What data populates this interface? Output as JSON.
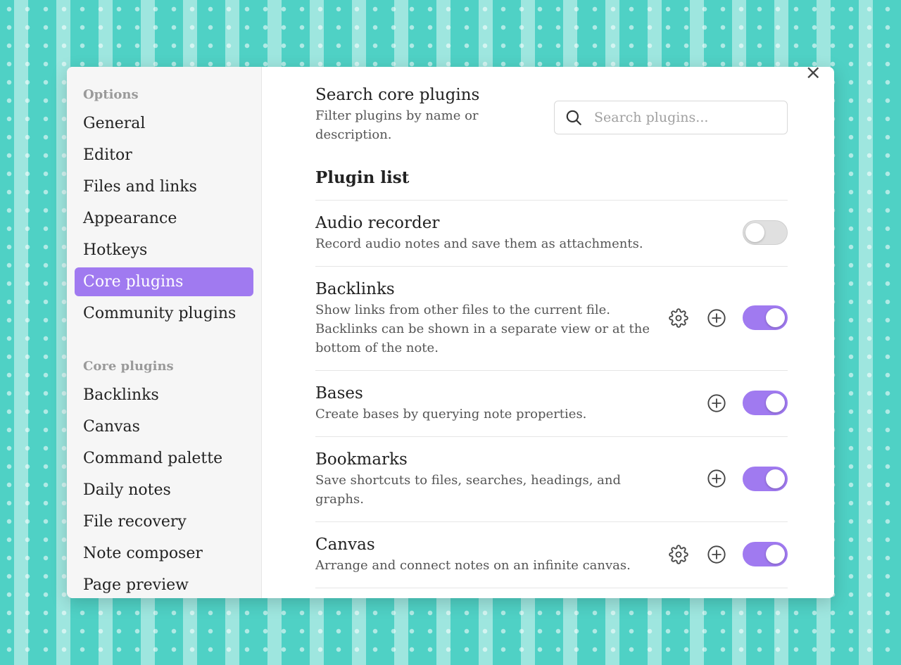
{
  "sidebar": {
    "options_heading": "Options",
    "options_items": [
      {
        "label": "General"
      },
      {
        "label": "Editor"
      },
      {
        "label": "Files and links"
      },
      {
        "label": "Appearance"
      },
      {
        "label": "Hotkeys"
      },
      {
        "label": "Core plugins",
        "active": true
      },
      {
        "label": "Community plugins"
      }
    ],
    "core_heading": "Core plugins",
    "core_items": [
      {
        "label": "Backlinks"
      },
      {
        "label": "Canvas"
      },
      {
        "label": "Command palette"
      },
      {
        "label": "Daily notes"
      },
      {
        "label": "File recovery"
      },
      {
        "label": "Note composer"
      },
      {
        "label": "Page preview"
      }
    ]
  },
  "close_icon": "×",
  "search": {
    "title": "Search core plugins",
    "description": "Filter plugins by name or description.",
    "placeholder": "Search plugins...",
    "value": ""
  },
  "plugin_list_heading": "Plugin list",
  "plugins": [
    {
      "name": "Audio recorder",
      "description": "Record audio notes and save them as attachments.",
      "settings": false,
      "hotkey": false,
      "enabled": false
    },
    {
      "name": "Backlinks",
      "description": "Show links from other files to the current file. Backlinks can be shown in a separate view or at the bottom of the note.",
      "settings": true,
      "hotkey": true,
      "enabled": true
    },
    {
      "name": "Bases",
      "description": "Create bases by querying note properties.",
      "settings": false,
      "hotkey": true,
      "enabled": true
    },
    {
      "name": "Bookmarks",
      "description": "Save shortcuts to files, searches, headings, and graphs.",
      "settings": false,
      "hotkey": true,
      "enabled": true
    },
    {
      "name": "Canvas",
      "description": "Arrange and connect notes on an infinite canvas.",
      "settings": true,
      "hotkey": true,
      "enabled": true
    }
  ],
  "colors": {
    "accent": "#a07af0",
    "background": "#4fd1c5"
  }
}
